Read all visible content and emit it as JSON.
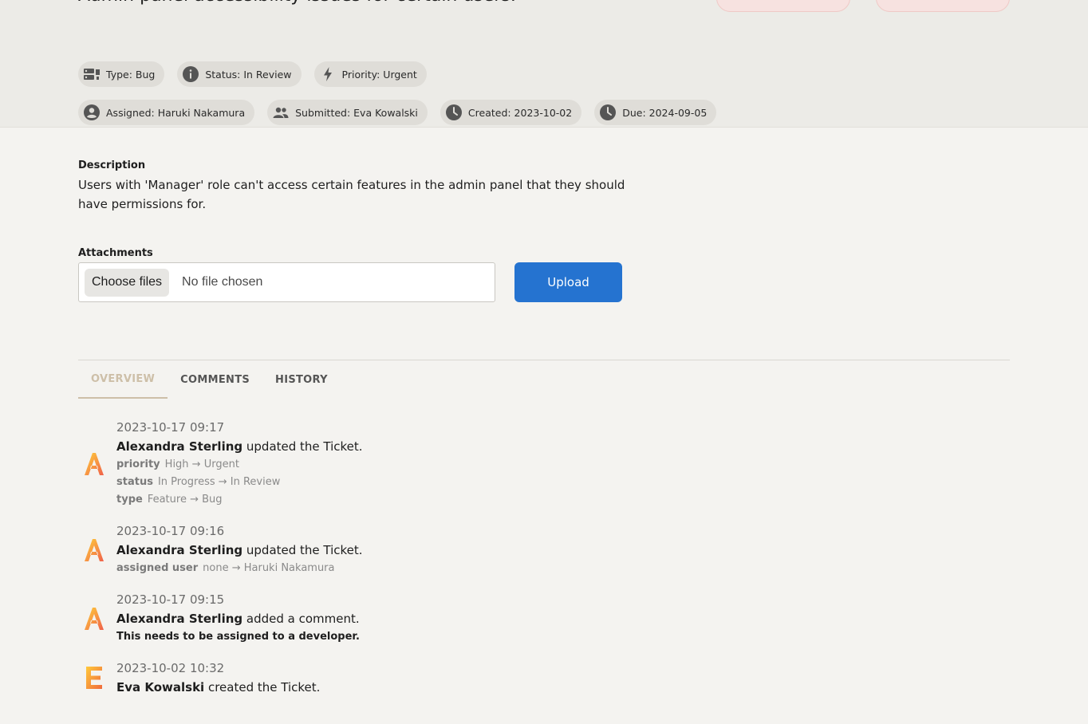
{
  "ticket": {
    "title": "Admin panel accessibility issues for certain users."
  },
  "chips": {
    "type": "Type: Bug",
    "status": "Status: In Review",
    "priority": "Priority: Urgent",
    "assigned": "Assigned: Haruki Nakamura",
    "submitted": "Submitted: Eva Kowalski",
    "created": "Created: 2023-10-02",
    "due": "Due: 2024-09-05"
  },
  "description": {
    "label": "Description",
    "text": "Users with 'Manager' role can't access certain features in the admin panel that they should have permissions for."
  },
  "attachments": {
    "label": "Attachments",
    "choose_label": "Choose files",
    "no_file_text": "No file chosen",
    "upload_label": "Upload"
  },
  "tabs": [
    "OVERVIEW",
    "COMMENTS",
    "HISTORY"
  ],
  "colors": {
    "upload": "#2573d0",
    "active_tab": "#cdbfa8",
    "avatar_a": "#f5a623",
    "avatar_e": "#f07a3c"
  },
  "history": [
    {
      "timestamp": "2023-10-17 09:17",
      "user": "Alexandra Sterling",
      "action": " updated the Ticket.",
      "avatar_letter": "A",
      "changes": [
        {
          "field": "priority",
          "value": "High → Urgent"
        },
        {
          "field": "status",
          "value": "In Progress → In Review"
        },
        {
          "field": "type",
          "value": "Feature → Bug"
        }
      ]
    },
    {
      "timestamp": "2023-10-17 09:16",
      "user": "Alexandra Sterling",
      "action": " updated the Ticket.",
      "avatar_letter": "A",
      "changes": [
        {
          "field": "assigned user",
          "value": "none → Haruki Nakamura"
        }
      ]
    },
    {
      "timestamp": "2023-10-17 09:15",
      "user": "Alexandra Sterling",
      "action": " added a comment.",
      "avatar_letter": "A",
      "comment": "This needs to be assigned to a developer."
    },
    {
      "timestamp": "2023-10-02 10:32",
      "user": "Eva Kowalski",
      "action": " created the Ticket.",
      "avatar_letter": "E"
    }
  ]
}
